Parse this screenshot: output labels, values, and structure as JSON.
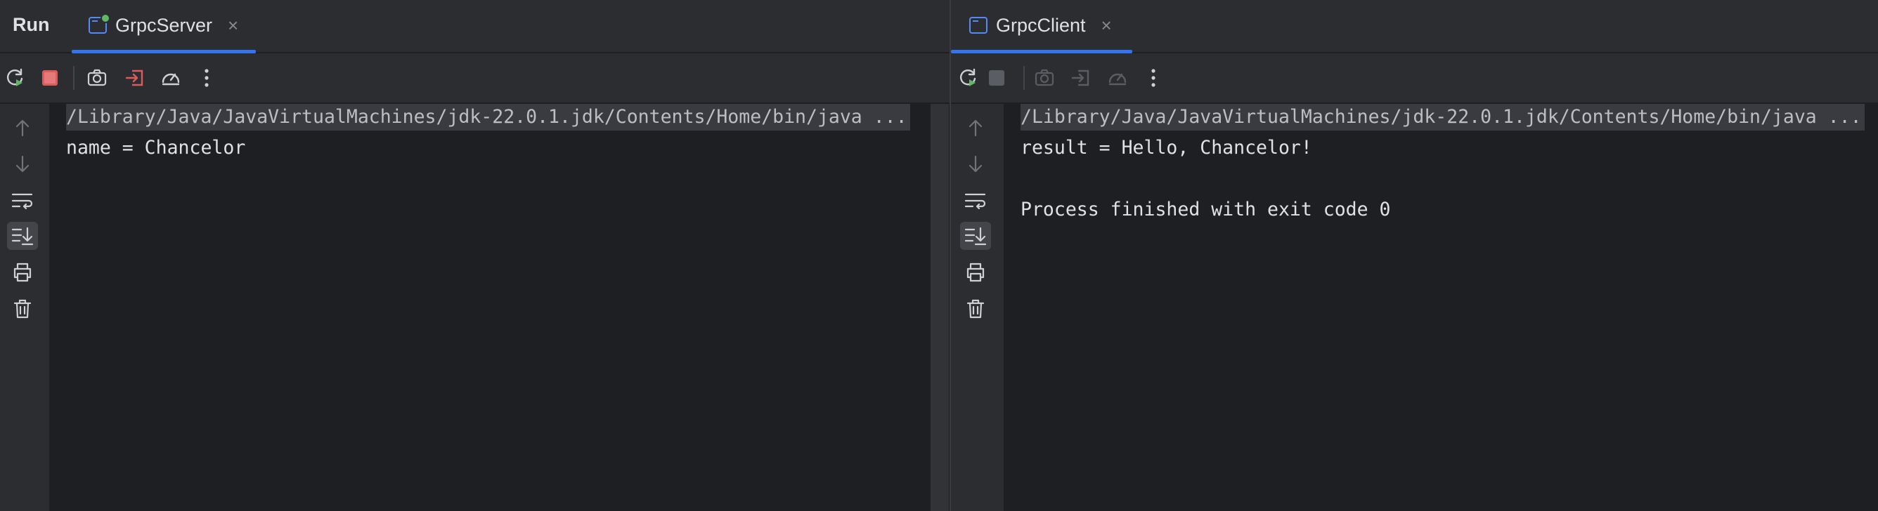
{
  "run_panel": {
    "title": "Run",
    "tabs": [
      {
        "label": "GrpcServer",
        "close": "×",
        "icon": "app-window-icon-running"
      },
      {
        "label": "GrpcClient",
        "close": "×",
        "icon": "app-window-icon"
      }
    ]
  },
  "toolbar": {
    "left_buttons": [
      "rerun-icon",
      "stop-icon",
      "camera-icon",
      "exit-icon",
      "profiler-icon",
      "more-vertical-icon"
    ],
    "right_buttons": [
      "rerun-icon",
      "stop-icon",
      "camera-icon",
      "exit-icon",
      "profiler-icon",
      "more-vertical-icon"
    ]
  },
  "gutter_icons": [
    "arrow-up-icon",
    "arrow-down-icon",
    "soft-wrap-icon",
    "scroll-to-end-icon",
    "print-icon",
    "trash-icon"
  ],
  "server_console": {
    "lines": [
      "/Library/Java/JavaVirtualMachines/jdk-22.0.1.jdk/Contents/Home/bin/java ...",
      "name = Chancelor"
    ]
  },
  "client_console": {
    "lines": [
      "/Library/Java/JavaVirtualMachines/jdk-22.0.1.jdk/Contents/Home/bin/java ...",
      "result = Hello, Chancelor!",
      "",
      "Process finished with exit code 0"
    ]
  },
  "colors": {
    "accent": "#3574f0",
    "stop_active": "#db5c5c",
    "rerun": "#5fb865",
    "panel_bg": "#2b2d30",
    "editor_bg": "#1e1f22"
  }
}
